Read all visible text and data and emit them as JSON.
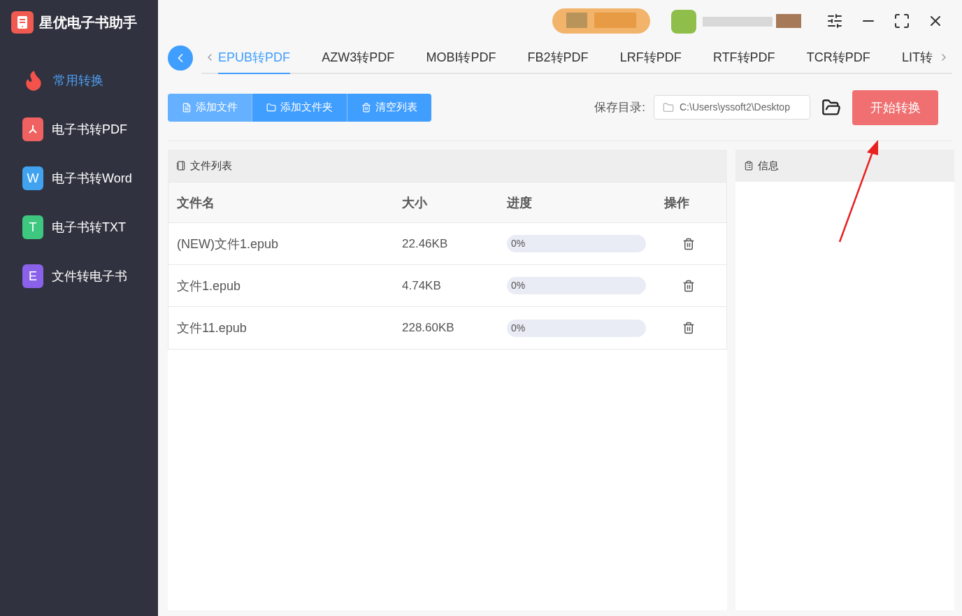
{
  "app": {
    "title": "星优电子书助手"
  },
  "sidebar": {
    "items": [
      {
        "label": "常用转换",
        "kind": "fire",
        "selected": true
      },
      {
        "label": "电子书转PDF",
        "kind": "pdf",
        "color": "#f06161",
        "selected": false
      },
      {
        "label": "电子书转Word",
        "kind": "letter",
        "letter": "W",
        "color": "#41a3f0",
        "selected": false
      },
      {
        "label": "电子书转TXT",
        "kind": "letter",
        "letter": "T",
        "color": "#3ec77f",
        "selected": false
      },
      {
        "label": "文件转电子书",
        "kind": "letter",
        "letter": "E",
        "color": "#8a62ea",
        "selected": false
      }
    ]
  },
  "tabs": [
    {
      "label": "EPUB转PDF",
      "selected": true
    },
    {
      "label": "AZW3转PDF",
      "selected": false
    },
    {
      "label": "MOBI转PDF",
      "selected": false
    },
    {
      "label": "FB2转PDF",
      "selected": false
    },
    {
      "label": "LRF转PDF",
      "selected": false
    },
    {
      "label": "RTF转PDF",
      "selected": false
    },
    {
      "label": "TCR转PDF",
      "selected": false
    },
    {
      "label": "LIT转",
      "selected": false
    }
  ],
  "toolbar": {
    "buttons": [
      {
        "label": "添加文件",
        "kind": "file",
        "highlighted": true
      },
      {
        "label": "添加文件夹",
        "kind": "folder",
        "highlighted": false
      },
      {
        "label": "清空列表",
        "kind": "trash",
        "highlighted": false
      }
    ],
    "save_label": "保存目录:",
    "save_path": "C:\\Users\\yssoft2\\Desktop",
    "start_button": "开始转换"
  },
  "file_list": {
    "title": "文件列表",
    "columns": [
      "文件名",
      "大小",
      "进度",
      "操作"
    ],
    "rows": [
      {
        "name": "(NEW)文件1.epub",
        "size": "22.46KB",
        "level": 0,
        "reading": "0%"
      },
      {
        "name": "文件1.epub",
        "size": "4.74KB",
        "level": 0,
        "reading": "0%"
      },
      {
        "name": "文件11.epub",
        "size": "228.60KB",
        "level": 0,
        "reading": "0%"
      }
    ]
  },
  "info_panel": {
    "title": "信息"
  }
}
